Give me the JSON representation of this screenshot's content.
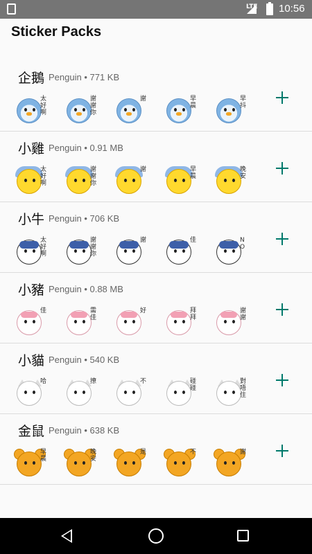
{
  "status_bar": {
    "network_label": "LTE",
    "time": "10:56"
  },
  "app_bar": {
    "title": "Sticker Packs"
  },
  "packs": [
    {
      "name": "企鵝",
      "meta": "Penguin • 771 KB",
      "theme": "penguin",
      "sticker_marks": [
        "太好啊",
        "謝謝你",
        "謝",
        "早晨",
        "早抖"
      ]
    },
    {
      "name": "小雞",
      "meta": "Penguin • 0.91 MB",
      "theme": "chick",
      "sticker_marks": [
        "太好啊",
        "謝謝你",
        "謝",
        "早晨",
        "晚安"
      ]
    },
    {
      "name": "小牛",
      "meta": "Penguin • 706 KB",
      "theme": "cow",
      "sticker_marks": [
        "太好啊",
        "謝謝你",
        "謝",
        "佳",
        "NO"
      ]
    },
    {
      "name": "小豬",
      "meta": "Penguin • 0.88 MB",
      "theme": "pig",
      "sticker_marks": [
        "佳",
        "需佳",
        "好",
        "拜拜",
        "謝謝"
      ]
    },
    {
      "name": "小貓",
      "meta": "Penguin • 540 KB",
      "theme": "cat",
      "sticker_marks": [
        "哈",
        "撩",
        "不",
        "碰碰",
        "對唔住"
      ]
    },
    {
      "name": "金鼠",
      "meta": "Penguin • 638 KB",
      "theme": "mouse",
      "sticker_marks": [
        "早晨",
        "晚安",
        "是",
        "不",
        "謝"
      ]
    }
  ],
  "colors": {
    "accent": "#00796b",
    "status_bar": "#757575",
    "divider": "#dcdcdc"
  },
  "icons": {
    "add": "plus-icon",
    "back": "back-triangle-icon",
    "home": "home-circle-icon",
    "recents": "recents-square-icon"
  }
}
